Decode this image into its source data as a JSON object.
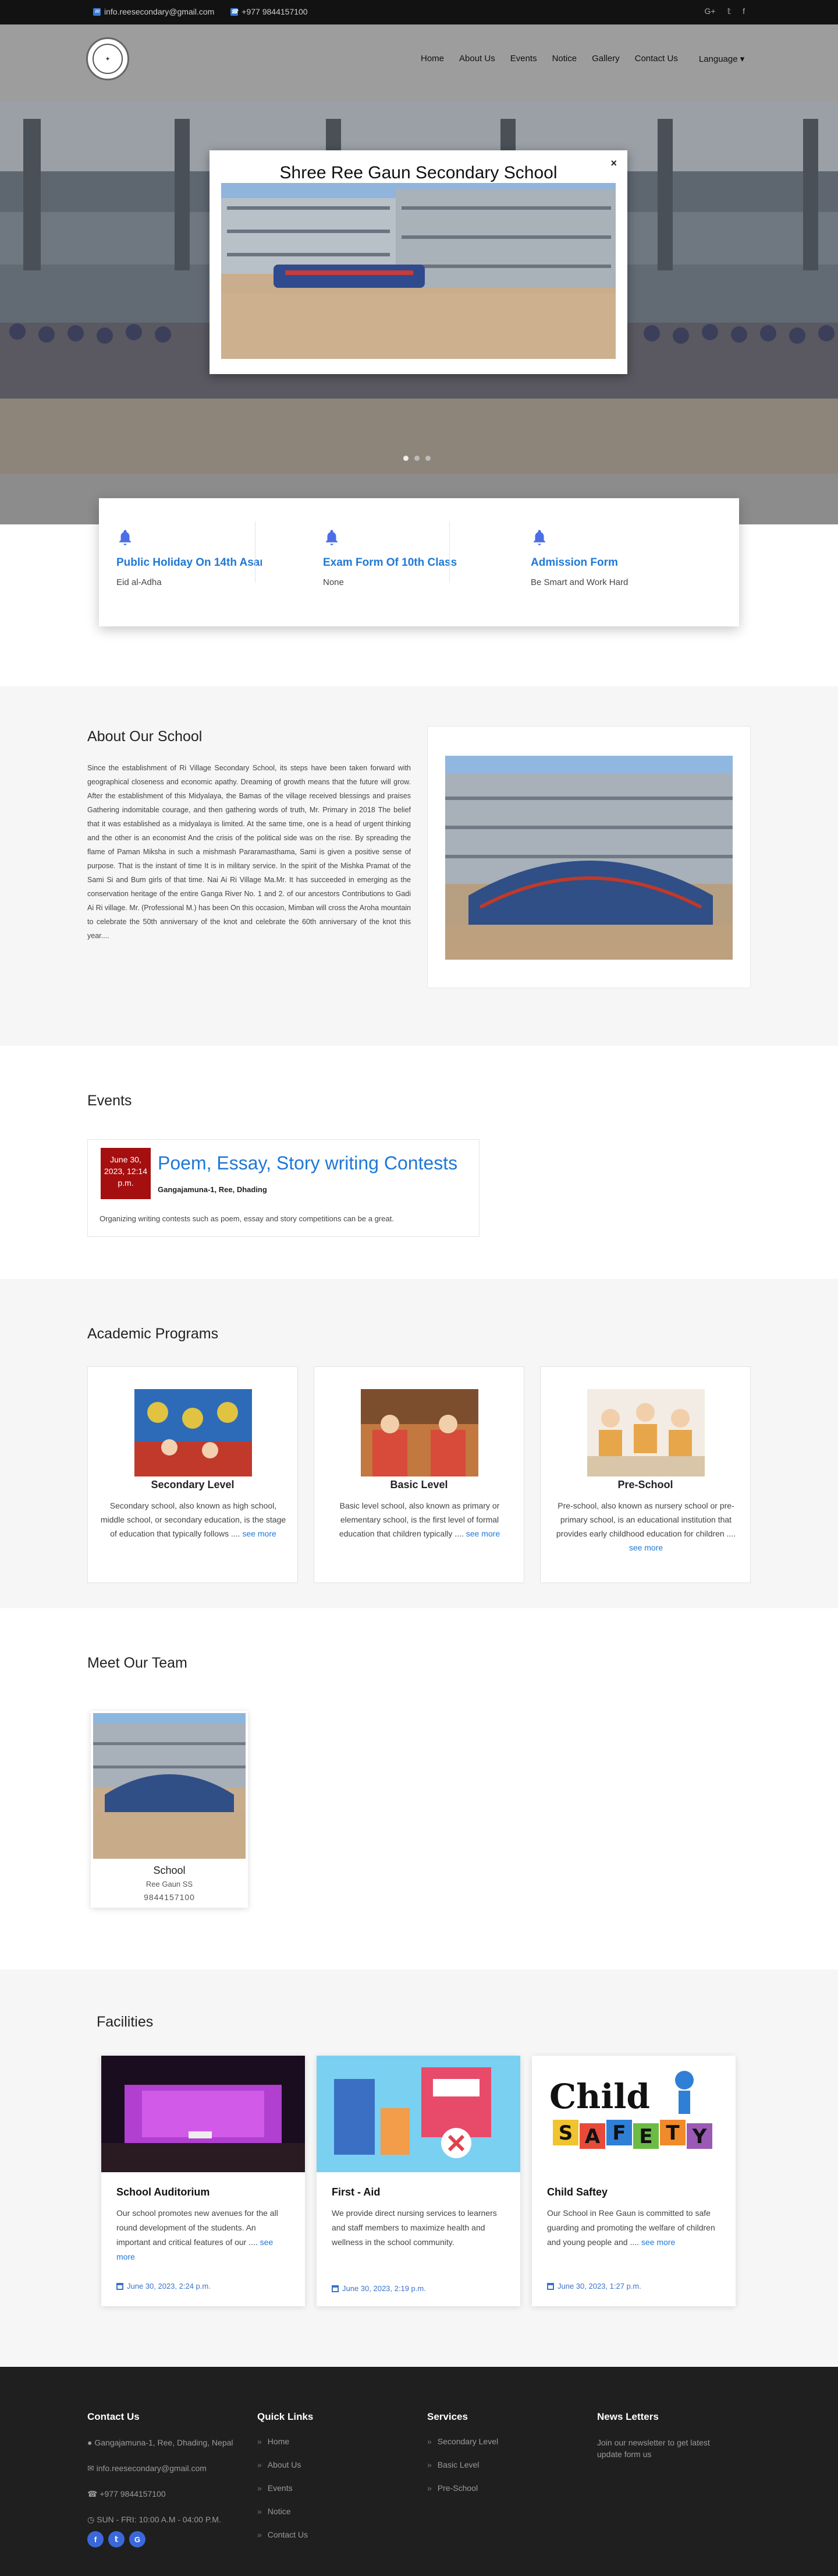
{
  "topbar": {
    "email": "info.reesecondary@gmail.com",
    "phone": "+977 9844157100",
    "social": [
      "G+",
      "𝕥",
      "f"
    ]
  },
  "nav": {
    "items": [
      "Home",
      "About Us",
      "Events",
      "Notice",
      "Gallery",
      "Contact Us"
    ],
    "language": "Language ▾"
  },
  "modal": {
    "title": "Shree Ree Gaun Secondary School",
    "close": "×"
  },
  "notices": [
    {
      "title": "Public Holiday On 14th Asar",
      "sub": "Eid al-Adha"
    },
    {
      "title": "Exam Form Of 10th Class",
      "sub": "None"
    },
    {
      "title": "Admission Form",
      "sub": "Be Smart and Work Hard"
    }
  ],
  "about": {
    "title": "About Our School",
    "text": "Since the establishment of Ri Village Secondary School, its steps have been taken forward with geographical closeness and economic apathy. Dreaming of growth means that the future will grow. After the establishment of this Midyalaya, the Bamas of the village received blessings and praises Gathering indomitable courage, and then gathering words of truth, Mr. Primary in 2018 The belief that it was established as a midyalaya is limited. At the same time, one is a head of urgent thinking and the other is an economist And the crisis of the political side was on the rise. By spreading the flame of Paman Miksha in such a mishmash Pararamasthama, Sami is given a positive sense of purpose. That is the instant of time It is in military service. In the spirit of the Mishka Pramat of the Sami Si and Bum girls of that time. Nai Ai Ri Village Ma.Mr. It has succeeded in emerging as the conservation heritage of the entire Ganga River No. 1 and 2. of our ancestors Contributions to Gadi Ai Ri village. Mr. (Professional M.) has been On this occasion, Mimban will cross the Aroha mountain to celebrate the 50th anniversary of the knot and celebrate the 60th anniversary of the knot this year...."
  },
  "events": {
    "title": "Events",
    "item": {
      "date": "June 30, 2023, 12:14 p.m.",
      "title": "Poem, Essay, Story writing Contests",
      "location": "Gangajamuna-1, Ree, Dhading",
      "desc": "Organizing writing contests such as poem, essay and story competitions can be a great."
    }
  },
  "programs": {
    "title": "Academic Programs",
    "items": [
      {
        "title": "Secondary Level",
        "desc": "Secondary school, also known as high school, middle school, or secondary education, is the stage of education that typically follows ....",
        "more": "see more"
      },
      {
        "title": "Basic Level",
        "desc": "Basic level school, also known as primary or elementary school, is the first level of formal education that children typically ....",
        "more": "see more"
      },
      {
        "title": "Pre-School",
        "desc": "Pre-school, also known as nursery school or pre-primary school, is an educational institution that provides early childhood education for children ....",
        "more": "see more"
      }
    ]
  },
  "team": {
    "title": "Meet Our Team",
    "member": {
      "name": "School",
      "role": "Ree Gaun SS",
      "phone": "9844157100"
    }
  },
  "facilities": {
    "title": "Facilities",
    "items": [
      {
        "title": "School Auditorium",
        "desc": "Our school promotes new avenues for the all round development of the students. An important and critical features of our ....",
        "more": "see more",
        "date": "June 30, 2023, 2:24 p.m."
      },
      {
        "title": "First - Aid",
        "desc": "We provide direct nursing services to learners and staff members to maximize health and wellness in the school community.",
        "more": "",
        "date": "June 30, 2023, 2:19 p.m."
      },
      {
        "title": "Child Saftey",
        "desc": "Our School in Ree Gaun is committed to safe guarding and promoting the welfare of children and young people and ....",
        "more": "see more",
        "date": "June 30, 2023, 1:27 p.m."
      }
    ],
    "child_safety_logo": "Child SAFETY"
  },
  "footer": {
    "contact": {
      "title": "Contact Us",
      "address": "Gangajamuna-1, Ree, Dhading, Nepal",
      "email": "info.reesecondary@gmail.com",
      "phone": "+977 9844157100",
      "hours": "SUN - FRI: 10:00 A.M - 04:00 P.M."
    },
    "quick": {
      "title": "Quick Links",
      "items": [
        "Home",
        "About Us",
        "Events",
        "Notice",
        "Contact Us"
      ]
    },
    "services": {
      "title": "Services",
      "items": [
        "Secondary Level",
        "Basic Level",
        "Pre-School"
      ]
    },
    "news": {
      "title": "News Letters",
      "text": "Join our newsletter to get latest update form us"
    }
  },
  "colors": {
    "accent": "#1f78d6",
    "date_badge": "#a50f0f",
    "topbar": "#121212",
    "footer": "#1f1f1f"
  }
}
